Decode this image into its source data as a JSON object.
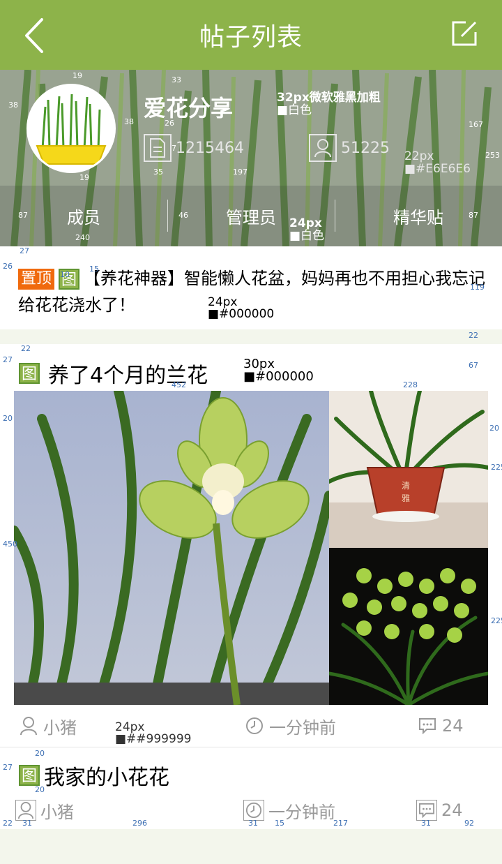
{
  "topbar": {
    "title": "帖子列表",
    "back_icon": "back-arrow-icon",
    "edit_icon": "edit-icon"
  },
  "group": {
    "name": "爱花分享",
    "post_count": "1215464",
    "member_count": "51225",
    "tabs": [
      "成员",
      "管理员",
      "精华贴"
    ]
  },
  "annotations": {
    "name_spec": "32px微软雅黑加粗",
    "name_color": "■白色",
    "stat_size": "22px",
    "stat_color": "■#E6E6E6",
    "tab_size": "24px",
    "tab_color": "■白色",
    "pinned_size": "24px",
    "pinned_color": "■#000000",
    "title_size": "30px",
    "title_color": "■#000000",
    "meta_size": "24px",
    "meta_color": "■##999999"
  },
  "dims": {
    "d38a": "38",
    "d38b": "38",
    "d19a": "19",
    "d33": "33",
    "d26": "26",
    "d7": "7",
    "d35": "35",
    "d197": "197",
    "d19b": "19",
    "d167": "167",
    "d253": "253",
    "d87a": "87",
    "d46": "46",
    "d240": "240",
    "d87b": "87",
    "d27a": "27",
    "d26b": "26",
    "d10": "10",
    "d15": "15",
    "d119": "119",
    "d22a": "22",
    "d22b": "22",
    "d27b": "27",
    "d67": "67",
    "d452": "452",
    "d228": "228",
    "d20a": "20",
    "d20b": "20",
    "d225a": "225",
    "d450": "450",
    "d225b": "225",
    "d27c": "27",
    "d20c": "20",
    "d20d": "20",
    "d22c": "22",
    "d31a": "31",
    "d296": "296",
    "d31b": "31",
    "d15b": "15",
    "d217": "217",
    "d31c": "31",
    "d92": "92"
  },
  "posts": [
    {
      "tags": [
        "置顶",
        "图"
      ],
      "title": "【养花神器】智能懒人花盆，妈妈再也不用担心我忘记给花花浇水了！"
    },
    {
      "tag": "图",
      "title": "养了4个月的兰花",
      "author": "小猪",
      "time": "一分钟前",
      "comments": "24"
    },
    {
      "tag": "图",
      "title": "我家的小花花",
      "author": "小猪",
      "time": "一分钟前",
      "comments": "24"
    }
  ],
  "colors": {
    "green": "#8db34a",
    "orange": "#f06a0e",
    "meta": "#999999",
    "stat": "#e6e6e6"
  }
}
